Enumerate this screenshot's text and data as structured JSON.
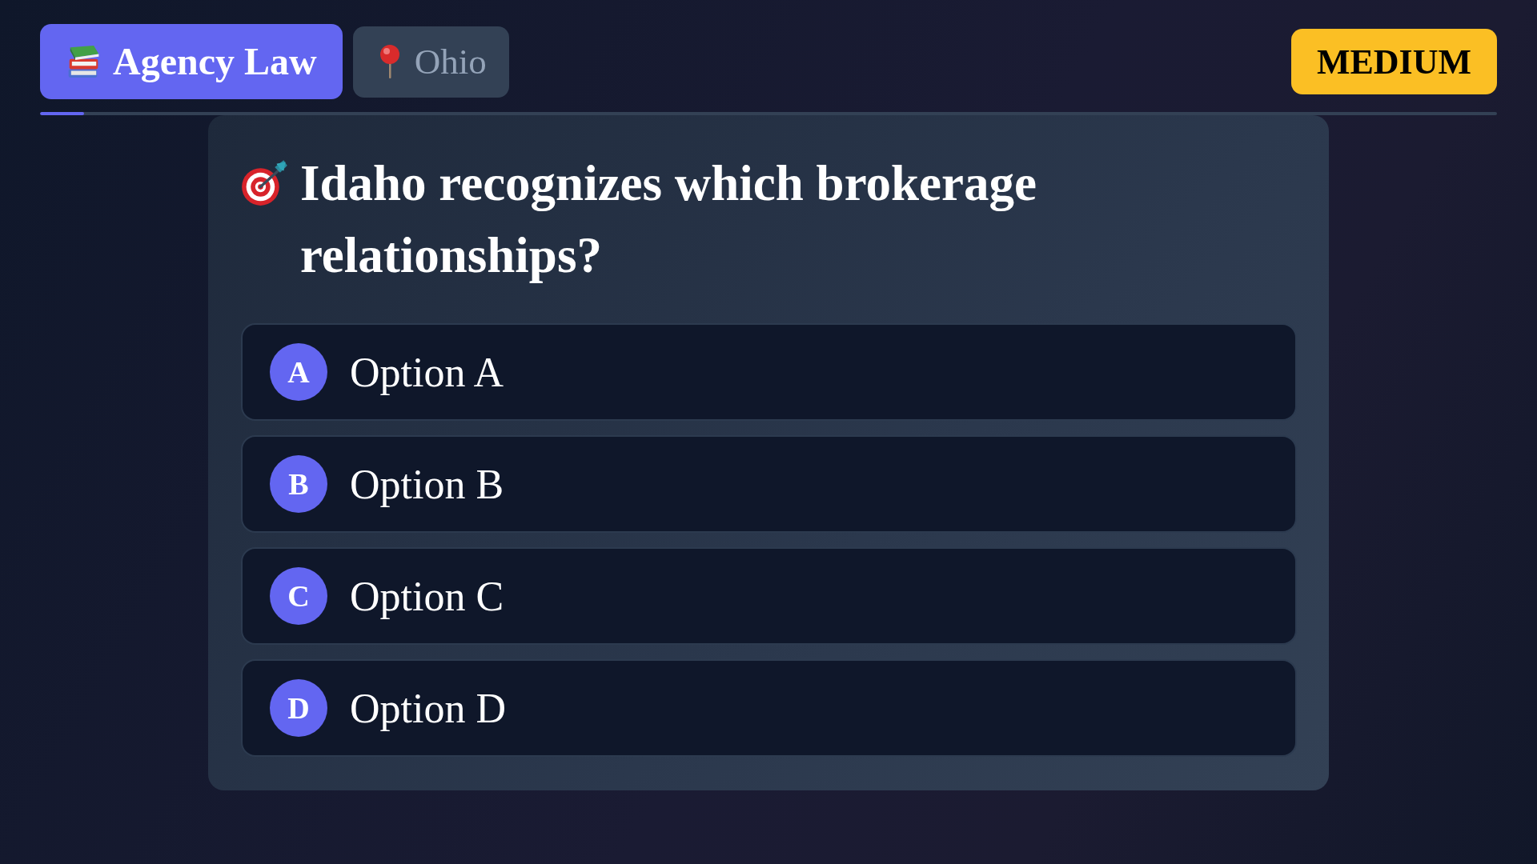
{
  "header": {
    "category": {
      "label": "Agency Law"
    },
    "location": {
      "label": "Ohio"
    },
    "difficulty": {
      "label": "MEDIUM"
    }
  },
  "progress": {
    "level": 0.03
  },
  "question": {
    "text": "Idaho recognizes which brokerage relationships?"
  },
  "options": [
    {
      "letter": "A",
      "label": "Option A",
      "selected": false
    },
    {
      "letter": "B",
      "label": "Option B",
      "selected": false
    },
    {
      "letter": "C",
      "label": "Option C",
      "selected": false
    },
    {
      "letter": "D",
      "label": "Option D",
      "selected": false
    }
  ]
}
